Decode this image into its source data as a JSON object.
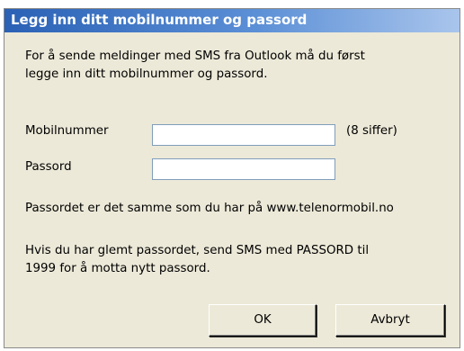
{
  "dialog": {
    "title": "Legg inn ditt mobilnummer og passord",
    "intro_line1": "For å sende meldinger med SMS fra Outlook må du først",
    "intro_line2": "legge inn ditt mobilnummer og passord.",
    "fields": {
      "mobile_label": "Mobilnummer",
      "mobile_value": "",
      "mobile_hint": "(8 siffer)",
      "password_label": "Passord",
      "password_value": ""
    },
    "password_note": "Passordet er det samme som du har på www.telenormobil.no",
    "forgot_line1": "Hvis du har glemt passordet, send SMS med PASSORD til",
    "forgot_line2": "1999 for å motta nytt passord.",
    "buttons": {
      "ok": "OK",
      "cancel": "Avbryt"
    }
  }
}
